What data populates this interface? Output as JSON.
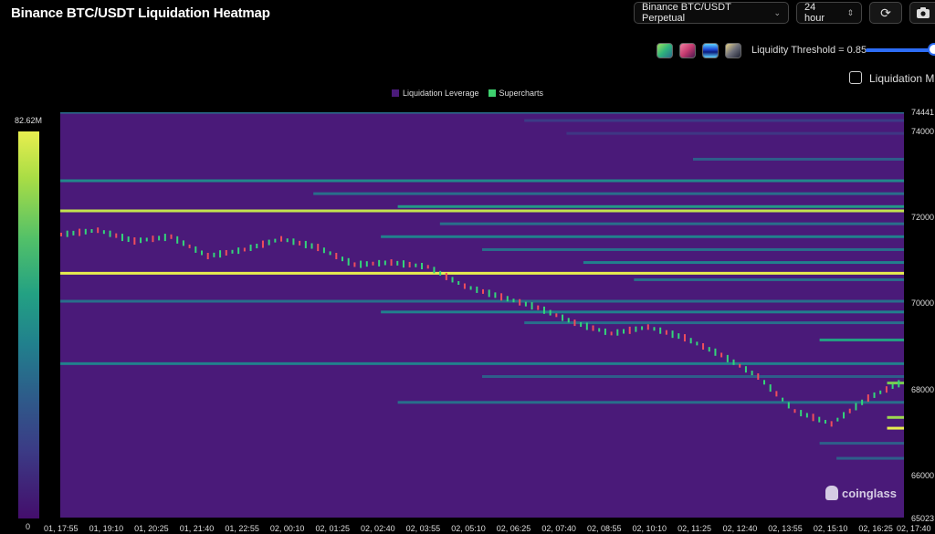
{
  "title": "Binance BTC/USDT Liquidation Heatmap",
  "toolbar": {
    "exchange_select": "Binance BTC/USDT Perpetual",
    "period_select": "24 hour",
    "refresh_icon": "refresh-icon",
    "camera_icon": "camera-icon"
  },
  "palette": [
    {
      "name": "palette-viridis",
      "colors": [
        "#57c96a",
        "#2a7f8e"
      ]
    },
    {
      "name": "palette-magma",
      "colors": [
        "#d2447a",
        "#5a1d5c"
      ]
    },
    {
      "name": "palette-blue",
      "colors": [
        "#1e4dd8",
        "#5fd3ff"
      ]
    },
    {
      "name": "palette-dark",
      "colors": [
        "#2a2e4a",
        "#e7d38a"
      ]
    }
  ],
  "threshold": {
    "label": "Liquidity Threshold = 0.85",
    "value": 0.85
  },
  "liquidation_mode_label": "Liquidation M",
  "legend": [
    {
      "label": "Liquidation Leverage",
      "color": "#4a1a79"
    },
    {
      "label": "Supercharts",
      "color": "#3fd16f"
    }
  ],
  "colorbar": {
    "max_label": "82.62M",
    "min_label": "0"
  },
  "watermark": "coinglass",
  "chart_data": {
    "type": "heatmap",
    "title": "Binance BTC/USDT Liquidation Heatmap",
    "y_ticks": [
      "74441",
      "74000",
      "72000",
      "70000",
      "68000",
      "66000",
      "65023"
    ],
    "ylim": [
      65023,
      74441
    ],
    "x_ticks": [
      "01, 17:55",
      "01, 19:10",
      "01, 20:25",
      "01, 21:40",
      "01, 22:55",
      "02, 00:10",
      "02, 01:25",
      "02, 02:40",
      "02, 03:55",
      "02, 05:10",
      "02, 06:25",
      "02, 07:40",
      "02, 08:55",
      "02, 10:10",
      "02, 11:25",
      "02, 12:40",
      "02, 13:55",
      "02, 15:10",
      "02, 16:25",
      "02, 17:40"
    ],
    "colorbar_range": [
      "0",
      "82.62M"
    ],
    "price_path": [
      [
        0,
        71600
      ],
      [
        1,
        71700
      ],
      [
        2,
        71450
      ],
      [
        3,
        71550
      ],
      [
        4,
        71100
      ],
      [
        5,
        71250
      ],
      [
        6,
        71500
      ],
      [
        7,
        71300
      ],
      [
        8,
        70900
      ],
      [
        9,
        70950
      ],
      [
        10,
        70850
      ],
      [
        11,
        70400
      ],
      [
        12,
        70150
      ],
      [
        13,
        69900
      ],
      [
        14,
        69550
      ],
      [
        15,
        69300
      ],
      [
        16,
        69450
      ],
      [
        17,
        69200
      ],
      [
        18,
        68800
      ],
      [
        19,
        68300
      ],
      [
        20,
        67500
      ],
      [
        21,
        67200
      ],
      [
        22,
        67800
      ],
      [
        23,
        68200
      ]
    ],
    "bands": [
      {
        "price": 74441,
        "intensity": 0.45,
        "start": 0
      },
      {
        "price": 74250,
        "intensity": 0.3,
        "start": 0.55
      },
      {
        "price": 73950,
        "intensity": 0.25,
        "start": 0.6
      },
      {
        "price": 73350,
        "intensity": 0.4,
        "start": 0.75
      },
      {
        "price": 72850,
        "intensity": 0.55,
        "start": 0
      },
      {
        "price": 72550,
        "intensity": 0.45,
        "start": 0.3
      },
      {
        "price": 72250,
        "intensity": 0.65,
        "start": 0.4
      },
      {
        "price": 72150,
        "intensity": 0.95,
        "start": 0
      },
      {
        "price": 71850,
        "intensity": 0.45,
        "start": 0.45
      },
      {
        "price": 71550,
        "intensity": 0.5,
        "start": 0.38
      },
      {
        "price": 71250,
        "intensity": 0.45,
        "start": 0.5
      },
      {
        "price": 70950,
        "intensity": 0.5,
        "start": 0.62
      },
      {
        "price": 70700,
        "intensity": 1.0,
        "start": 0
      },
      {
        "price": 70550,
        "intensity": 0.45,
        "start": 0.68
      },
      {
        "price": 70050,
        "intensity": 0.45,
        "start": 0
      },
      {
        "price": 69800,
        "intensity": 0.5,
        "start": 0.38
      },
      {
        "price": 69550,
        "intensity": 0.45,
        "start": 0.55
      },
      {
        "price": 69150,
        "intensity": 0.7,
        "start": 0.9
      },
      {
        "price": 68600,
        "intensity": 0.5,
        "start": 0
      },
      {
        "price": 68300,
        "intensity": 0.4,
        "start": 0.5
      },
      {
        "price": 68150,
        "intensity": 0.85,
        "start": 0.98
      },
      {
        "price": 67700,
        "intensity": 0.45,
        "start": 0.4
      },
      {
        "price": 67350,
        "intensity": 0.9,
        "start": 0.98
      },
      {
        "price": 67100,
        "intensity": 1.0,
        "start": 0.98
      },
      {
        "price": 66750,
        "intensity": 0.4,
        "start": 0.9
      },
      {
        "price": 66400,
        "intensity": 0.4,
        "start": 0.92
      }
    ]
  }
}
